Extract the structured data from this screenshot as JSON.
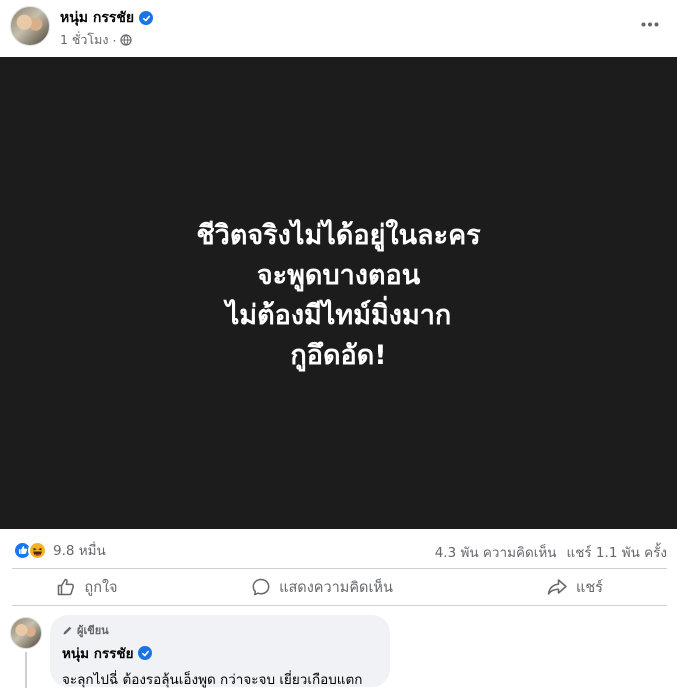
{
  "post": {
    "author": "หนุ่ม กรรชัย",
    "time": "1 ชั่วโมง",
    "separator": "·"
  },
  "image_text": {
    "lines": [
      "ชีวิตจริงไม่ได้อยู่ในละคร",
      "จะพูดบางตอน",
      "ไม่ต้องมีไทม์มิ่งมาก",
      "กูอึดอัด!"
    ]
  },
  "stats": {
    "reactions_count": "9.8 หมื่น",
    "comments": "4.3 พัน ความคิดเห็น",
    "shares": "แชร์ 1.1 พัน ครั้ง"
  },
  "actions": {
    "like": "ถูกใจ",
    "comment": "แสดงความคิดเห็น",
    "share": "แชร์"
  },
  "comment": {
    "badge": "ผู้เขียน",
    "author": "หนุ่ม กรรชัย",
    "text": "จะลุกไปฉี่ ต้องรอลุ้นเอ็งพูด กว่าจะจบ เยี่ยวเกือบแตก"
  },
  "colors": {
    "accent": "#1877f2",
    "verified": "#1b74e4",
    "image_bg": "#1c1c1c",
    "muted_text": "#65676b"
  },
  "icons": [
    "verified-icon",
    "globe-icon",
    "more-icon",
    "like-reaction-icon",
    "haha-reaction-icon",
    "thumb-up-icon",
    "comment-icon",
    "share-icon",
    "pencil-icon"
  ]
}
